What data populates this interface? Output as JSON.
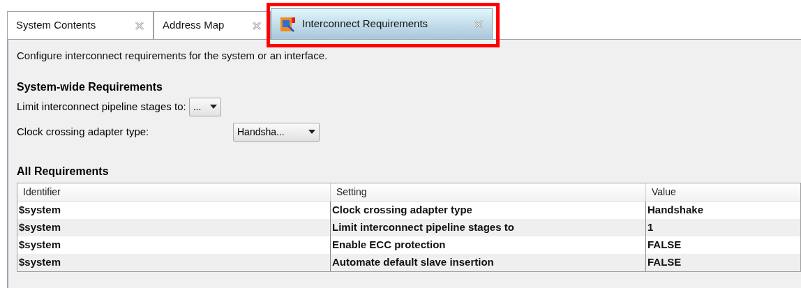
{
  "tabs": [
    {
      "label": "System Contents",
      "selected": false
    },
    {
      "label": "Address Map",
      "selected": false
    },
    {
      "label": "Interconnect Requirements",
      "selected": true
    }
  ],
  "description": "Configure interconnect requirements for the system or an interface.",
  "system_wide": {
    "title": "System-wide Requirements",
    "fields": [
      {
        "label": "Limit interconnect pipeline stages to:",
        "value": "..."
      },
      {
        "label": "Clock crossing adapter type:",
        "value": "Handsha..."
      }
    ]
  },
  "all_requirements": {
    "title": "All Requirements",
    "columns": [
      "Identifier",
      "Setting",
      "Value"
    ],
    "rows": [
      [
        "$system",
        "Clock crossing adapter type",
        "Handshake"
      ],
      [
        "$system",
        "Limit interconnect pipeline stages to",
        "1"
      ],
      [
        "$system",
        "Enable ECC protection",
        "FALSE"
      ],
      [
        "$system",
        "Automate default slave insertion",
        "FALSE"
      ]
    ]
  }
}
